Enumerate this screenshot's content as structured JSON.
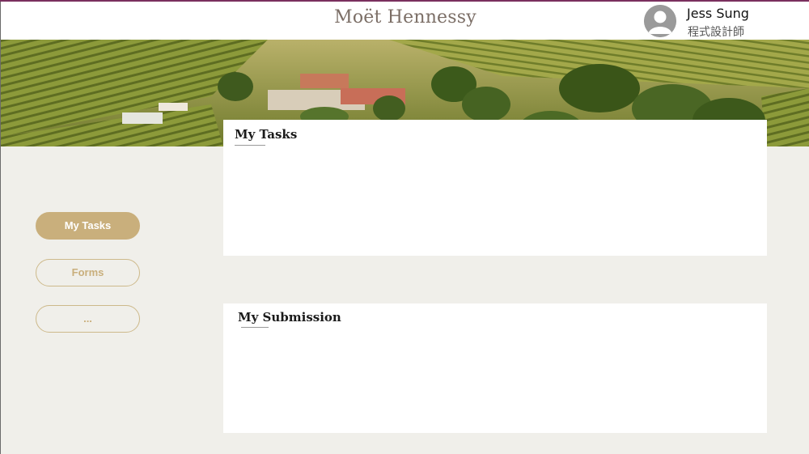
{
  "header": {
    "brand": "Moët Hennessy",
    "user": {
      "name": "Jess Sung",
      "role": "程式設計師"
    }
  },
  "sidebar": {
    "items": [
      {
        "label": "My Tasks",
        "active": true
      },
      {
        "label": "Forms",
        "active": false
      },
      {
        "label": "...",
        "active": false
      }
    ]
  },
  "main": {
    "tasks_panel": {
      "title": "My Tasks"
    },
    "submission_panel": {
      "title": "My Submission"
    }
  },
  "colors": {
    "accent_gold": "#c9af7c",
    "background": "#f0efea",
    "brand_text": "#7b6e66",
    "top_accent": "#7a2f5e"
  },
  "icons": {
    "avatar": "user-avatar-icon"
  }
}
